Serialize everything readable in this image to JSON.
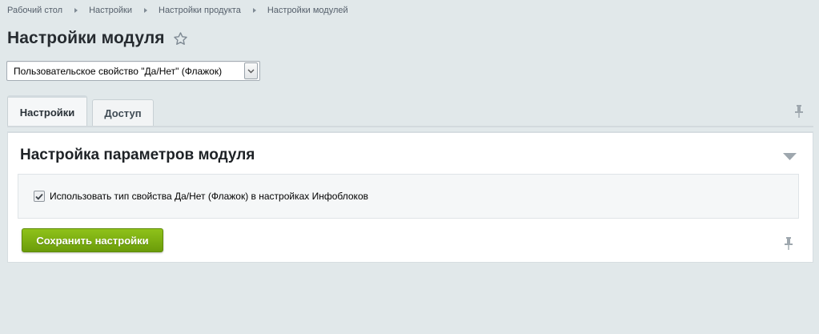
{
  "breadcrumb": {
    "items": [
      "Рабочий стол",
      "Настройки",
      "Настройки продукта",
      "Настройки модулей"
    ]
  },
  "page": {
    "title": "Настройки модуля"
  },
  "module_select": {
    "selected": "Пользовательское свойство \"Да/Нет\" (Флажок)"
  },
  "tabs": [
    {
      "label": "Настройки",
      "active": true
    },
    {
      "label": "Доступ",
      "active": false
    }
  ],
  "section": {
    "title": "Настройка параметров модуля",
    "option_label": "Использовать тип свойства Да/Нет (Флажок) в настройках Инфоблоков",
    "option_checked": true
  },
  "actions": {
    "save_label": "Сохранить настройки"
  },
  "icons": {
    "star": "star-icon",
    "pin": "pin-icon",
    "collapse": "triangle-down-icon",
    "chevron": "chevron-down-icon",
    "check": "check-icon"
  },
  "colors": {
    "background": "#e1e8ea",
    "save_button": "#7aae12",
    "text_link": "#555f6b"
  }
}
